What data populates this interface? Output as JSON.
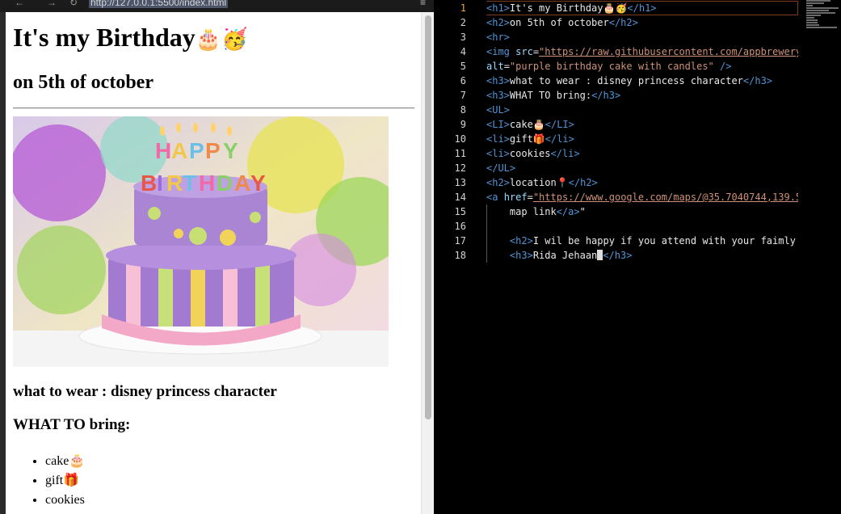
{
  "browser": {
    "url": "http://127.0.0.1:5500/index.html",
    "page": {
      "h1": "It's my Birthday",
      "h1_emoji": "🎂🥳",
      "h2": "on 5th of october",
      "img_alt": "purple birthday cake with candles",
      "wear": "what to wear : disney princess character",
      "bring": "WHAT TO bring:",
      "items": [
        {
          "label": "cake",
          "emoji": "🎂"
        },
        {
          "label": "gift",
          "emoji": "🎁"
        },
        {
          "label": "cookies",
          "emoji": ""
        }
      ]
    }
  },
  "editor": {
    "active_line": 1,
    "line_numbers": [
      "1",
      "2",
      "3",
      "4",
      "5",
      "6",
      "7",
      "8",
      "9",
      "10",
      "11",
      "12",
      "13",
      "14",
      "15",
      "16",
      "17",
      "18"
    ],
    "lines": {
      "l1": {
        "open": "<h1>",
        "text": "It's my Birthday🎂🥳",
        "close": "</h1>"
      },
      "l2": {
        "open": "<h2>",
        "text": "on 5th of october",
        "close": "</h2>"
      },
      "l3": {
        "tag": "<hr>"
      },
      "l4": {
        "open": "<img ",
        "attr": "src",
        "eq": "=",
        "val": "\"https://raw.githubusercontent.com/appbrewery"
      },
      "l5": {
        "attr": "alt",
        "eq": "=",
        "val": "\"purple birthday cake with candles\"",
        "close": " />"
      },
      "l6": {
        "open": "<h3>",
        "text": "what to wear : disney princess character",
        "close": "</h3>"
      },
      "l7": {
        "open": "<h3>",
        "text": "WHAT TO bring:",
        "close": "</h3>"
      },
      "l8": {
        "tag": "<UL>"
      },
      "l9": {
        "open": "<LI>",
        "text": "cake🎂",
        "close": "</LI>"
      },
      "l10": {
        "open": "<li>",
        "text": "gift🎁",
        "close": "</li>"
      },
      "l11": {
        "open": "<li>",
        "text": "cookies",
        "close": "</li>"
      },
      "l12": {
        "tag": "</UL>"
      },
      "l13": {
        "open": "<h2>",
        "text": "location📍",
        "close": "</h2>"
      },
      "l14": {
        "open": "<a ",
        "attr": "href",
        "eq": "=",
        "val": "\"https://www.google.com/maps/@35.7040744,139.5"
      },
      "l15": {
        "text": "    map link",
        "close": "</a>",
        "tail": "\""
      },
      "l16": {
        "text": ""
      },
      "l17": {
        "text": "    ",
        "open": "<h2>",
        "text2": "I wil be happy if you attend with your faimly"
      },
      "l18": {
        "text": "    ",
        "open": "<h3>",
        "text2": "Rida Jehaan",
        "close": "</h3>"
      }
    }
  }
}
